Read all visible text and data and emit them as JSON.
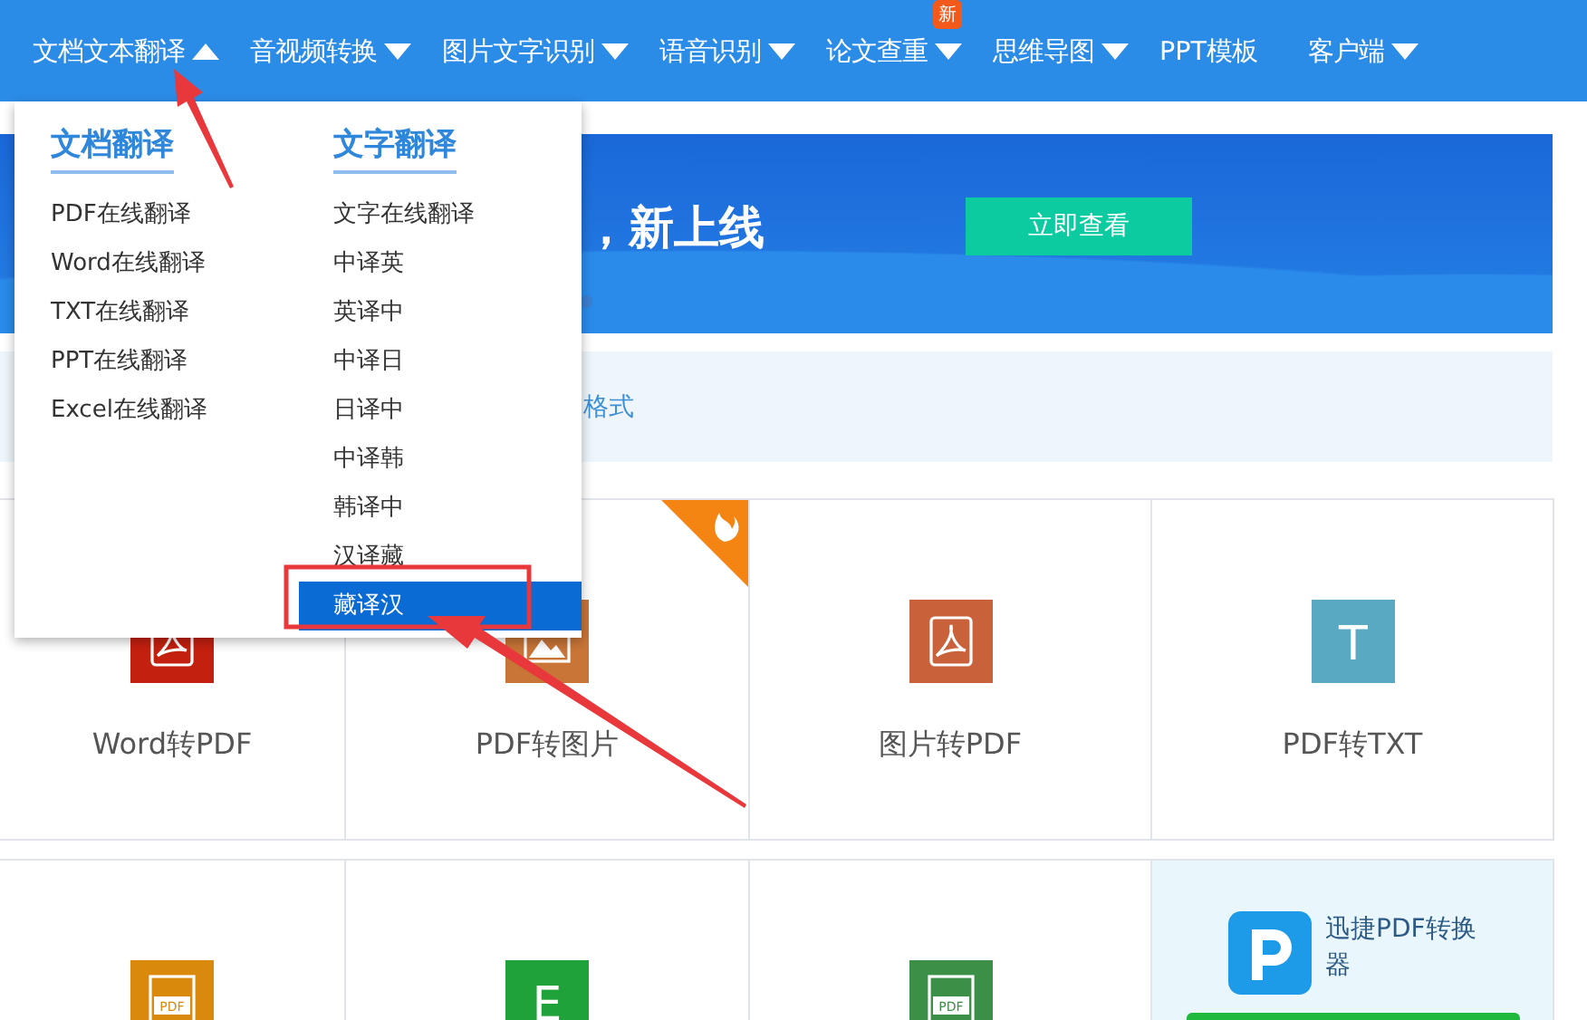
{
  "nav": {
    "items": [
      {
        "label": "文档文本翻译",
        "expanded": true
      },
      {
        "label": "音视频转换",
        "expanded": false
      },
      {
        "label": "图片文字识别",
        "expanded": false
      },
      {
        "label": "语音识别",
        "expanded": false
      },
      {
        "label": "论文查重",
        "expanded": false,
        "badge": "新"
      },
      {
        "label": "思维导图",
        "expanded": false
      },
      {
        "label": "PPT模板"
      },
      {
        "label": "客户端",
        "expanded": false
      }
    ]
  },
  "dropdown": {
    "sections": [
      {
        "heading": "文档翻译",
        "items": [
          {
            "label": "PDF在线翻译",
            "selected": false
          },
          {
            "label": "Word在线翻译",
            "selected": false
          },
          {
            "label": "TXT在线翻译",
            "selected": false
          },
          {
            "label": "PPT在线翻译",
            "selected": false
          },
          {
            "label": "Excel在线翻译",
            "selected": false
          }
        ]
      },
      {
        "heading": "文字翻译",
        "items": [
          {
            "label": "文字在线翻译",
            "selected": false
          },
          {
            "label": "中译英",
            "selected": false
          },
          {
            "label": "英译中",
            "selected": false
          },
          {
            "label": "中译日",
            "selected": false
          },
          {
            "label": "日译中",
            "selected": false
          },
          {
            "label": "中译韩",
            "selected": false
          },
          {
            "label": "韩译中",
            "selected": false
          },
          {
            "label": "汉译藏",
            "selected": false
          },
          {
            "label": "藏译汉",
            "selected": true
          }
        ]
      }
    ]
  },
  "banner": {
    "headline": "，新上线",
    "button": "立即查看"
  },
  "notice": {
    "text": "格式"
  },
  "tools": [
    [
      {
        "kind": "pdf",
        "label": "Word转PDF",
        "color": "#c4200f",
        "hot": false
      },
      {
        "kind": "image",
        "label": "PDF转图片",
        "color": "#c87537",
        "hot": true
      },
      {
        "kind": "pdf",
        "label": "图片转PDF",
        "color": "#c9613a",
        "hot": false
      },
      {
        "kind": "letter",
        "label": "PDF转TXT",
        "icon_label": "T",
        "color": "#58a9c1",
        "hot": false
      }
    ],
    [
      {
        "kind": "doc",
        "icon_label": "PDF",
        "color": "#d98a0c",
        "hot": false
      },
      {
        "kind": "letter",
        "icon_label": "E",
        "color": "#1fa23a",
        "hot": false
      },
      {
        "kind": "doc",
        "icon_label": "PDF",
        "color": "#3c8f47",
        "hot": false
      },
      {
        "kind": "promo",
        "title": "迅捷PDF转换器"
      }
    ]
  ]
}
